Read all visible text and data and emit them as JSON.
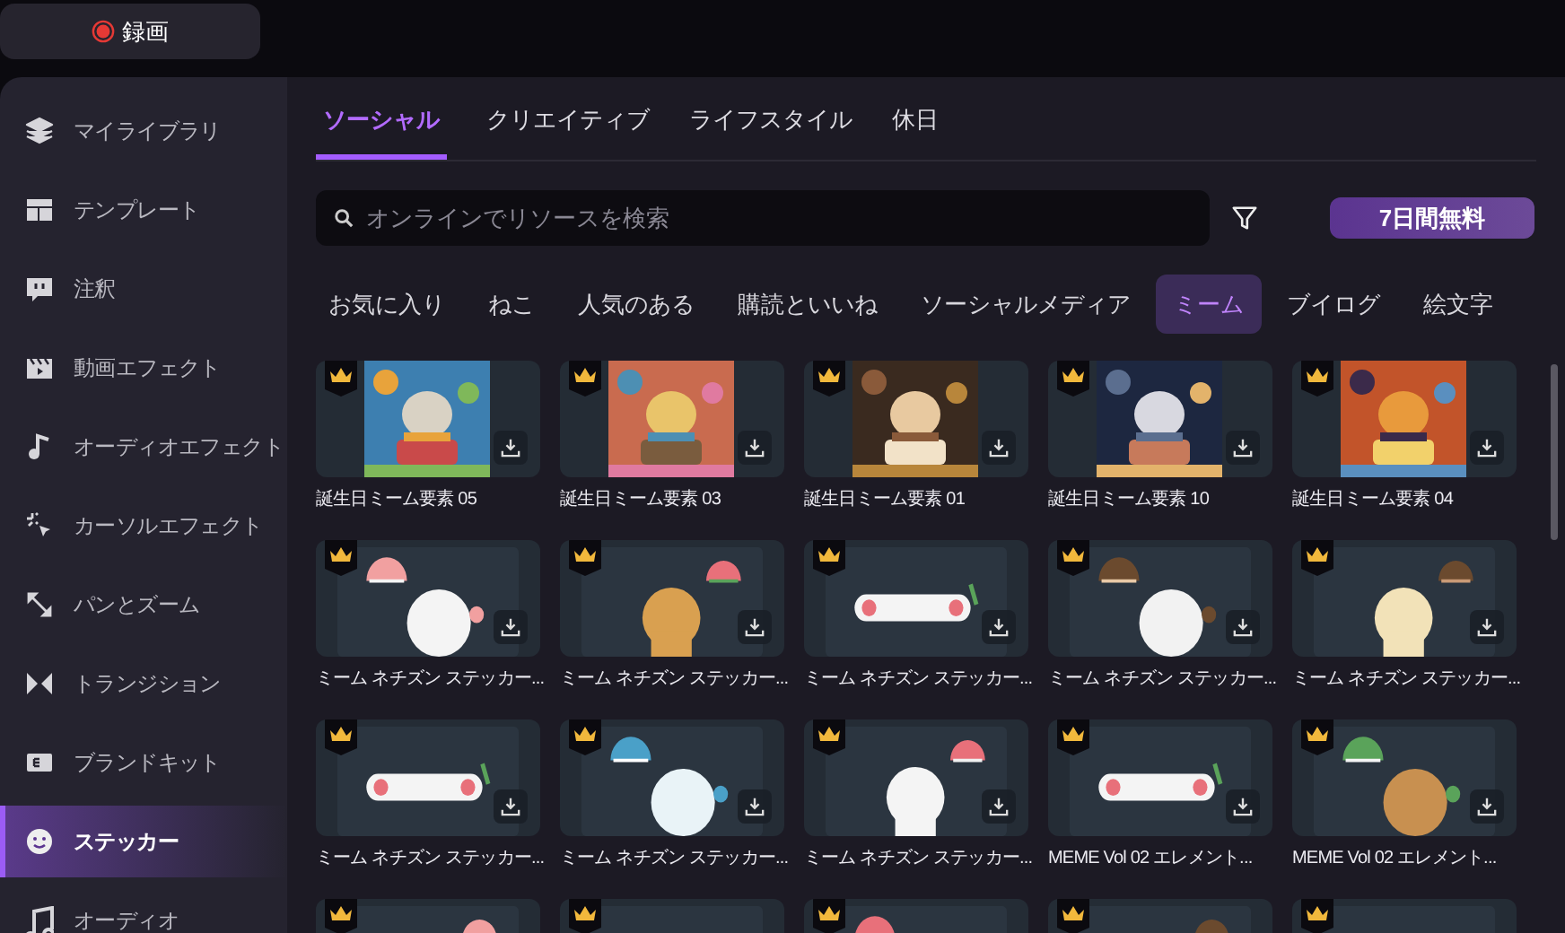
{
  "record_button": {
    "label": "録画"
  },
  "sidebar": {
    "items": [
      {
        "label": "マイライブラリ",
        "selected": false
      },
      {
        "label": "テンプレート",
        "selected": false
      },
      {
        "label": "注釈",
        "selected": false
      },
      {
        "label": "動画エフェクト",
        "selected": false
      },
      {
        "label": "オーディオエフェクト",
        "selected": false
      },
      {
        "label": "カーソルエフェクト",
        "selected": false
      },
      {
        "label": "パンとズーム",
        "selected": false
      },
      {
        "label": "トランジション",
        "selected": false
      },
      {
        "label": "ブランドキット",
        "selected": false
      },
      {
        "label": "ステッカー",
        "selected": true
      },
      {
        "label": "オーディオ",
        "selected": false
      }
    ]
  },
  "tabs": [
    {
      "label": "ソーシャル",
      "selected": true
    },
    {
      "label": "クリエイティブ",
      "selected": false
    },
    {
      "label": "ライフスタイル",
      "selected": false
    },
    {
      "label": "休日",
      "selected": false
    }
  ],
  "search": {
    "placeholder": "オンラインでリソースを検索"
  },
  "trial_button": {
    "label": "7日間無料"
  },
  "categories": [
    {
      "label": "お気に入り",
      "selected": false
    },
    {
      "label": "ねこ",
      "selected": false
    },
    {
      "label": "人気のある",
      "selected": false
    },
    {
      "label": "購読といいね",
      "selected": false
    },
    {
      "label": "ソーシャルメディア",
      "selected": false
    },
    {
      "label": "ミーム",
      "selected": true
    },
    {
      "label": "ブイログ",
      "selected": false
    },
    {
      "label": "絵文字",
      "selected": false
    }
  ],
  "items": [
    {
      "title": "誕生日ミーム要素 05",
      "premium": true
    },
    {
      "title": "誕生日ミーム要素 03",
      "premium": true
    },
    {
      "title": "誕生日ミーム要素 01",
      "premium": true
    },
    {
      "title": "誕生日ミーム要素 10",
      "premium": true
    },
    {
      "title": "誕生日ミーム要素 04",
      "premium": true
    },
    {
      "title": "ミーム ネチズン ステッカー...",
      "kind": "sticker",
      "premium": true
    },
    {
      "title": "ミーム ネチズン ステッカー...",
      "kind": "sticker",
      "premium": true
    },
    {
      "title": "ミーム ネチズン ステッカー...",
      "kind": "sticker",
      "premium": true
    },
    {
      "title": "ミーム ネチズン ステッカー...",
      "kind": "sticker",
      "premium": true
    },
    {
      "title": "ミーム ネチズン ステッカー...",
      "kind": "sticker",
      "premium": true
    },
    {
      "title": "ミーム ネチズン ステッカー...",
      "kind": "sticker",
      "premium": true
    },
    {
      "title": "ミーム ネチズン ステッカー...",
      "kind": "sticker",
      "premium": true
    },
    {
      "title": "ミーム ネチズン ステッカー...",
      "kind": "sticker",
      "premium": true
    },
    {
      "title": "MEME Vol 02 エレメント...",
      "kind": "sticker",
      "premium": true
    },
    {
      "title": "MEME Vol 02 エレメント...",
      "kind": "sticker",
      "premium": true
    },
    {
      "kind": "sticker",
      "premium": true
    },
    {
      "kind": "sticker",
      "premium": true
    },
    {
      "kind": "sticker",
      "premium": true
    },
    {
      "kind": "sticker",
      "premium": true
    },
    {
      "kind": "sticker",
      "premium": true
    }
  ]
}
